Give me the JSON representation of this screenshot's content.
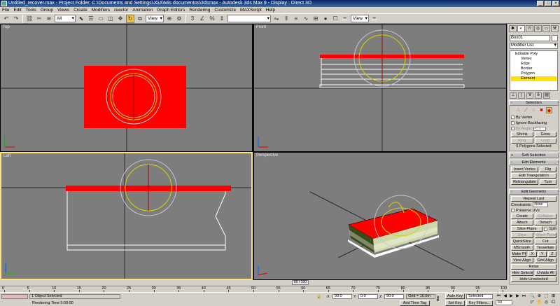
{
  "window": {
    "title": "Untitled_recover.max     - Project Folder: C:\\Documents and Settings\\JGA\\Mis documentos\\3dsmax     - Autodesk 3ds Max 9     - Display : Direct 3D",
    "controls": [
      "_",
      "□",
      "×"
    ]
  },
  "menu": [
    "File",
    "Edit",
    "Tools",
    "Group",
    "Views",
    "Create",
    "Modifiers",
    "reactor",
    "Animation",
    "Graph Editors",
    "Rendering",
    "Customize",
    "MAXScript",
    "Help"
  ],
  "toolbar": {
    "filter": "All",
    "refcoord": "View",
    "named_selection": "",
    "view2": "View"
  },
  "viewports": {
    "top": "Top",
    "front": "Front",
    "left": "Left",
    "perspective": "Perspective"
  },
  "panel": {
    "object_name": "Box01",
    "modifier_list": "Modifier List",
    "stack": {
      "root": "Editable Poly",
      "items": [
        "Vertex",
        "Edge",
        "Border",
        "Polygon",
        "Element"
      ],
      "selected": "Element"
    },
    "selection": {
      "title": "Selection",
      "by_vertex": "By Vertex",
      "ignore_backfacing": "Ignore Backfacing",
      "by_angle": "By Angle:",
      "angle_value": "45.0",
      "shrink": "Shrink",
      "grow": "Grow",
      "ring": "Ring",
      "loop": "Loop",
      "status": "6 Polygons Selected"
    },
    "soft_selection": "Soft Selection",
    "edit_elements": {
      "title": "Edit Elements",
      "insert_vertex": "Insert Vertex",
      "flip": "Flip",
      "edit_triangulation": "Edit Triangulation",
      "retriangulate": "Retriangulate",
      "turn": "Turn"
    },
    "edit_geometry": {
      "title": "Edit Geometry",
      "repeat_last": "Repeat Last",
      "constraints": "Constraints:",
      "constraints_value": "None",
      "preserve_uvs": "Preserve UVs",
      "create": "Create",
      "collapse": "Collapse",
      "attach": "Attach",
      "detach": "Detach",
      "slice_plane": "Slice Plane",
      "split": "Split",
      "slice": "Slice",
      "reset_plane": "Reset Plane",
      "quickslice": "QuickSlice",
      "cut": "Cut",
      "msmooth": "MSmooth",
      "tessellate": "Tessellate",
      "make_planar": "Make Planar",
      "x": "X",
      "y": "Y",
      "z": "Z",
      "view_align": "View Align",
      "grid_align": "Grid Align",
      "relax": "Relax",
      "hide_selected": "Hide Selected",
      "unhide_all": "Unhide All",
      "hide_unselected": "Hide Unselected"
    }
  },
  "timeline": {
    "slider": "60 / 100",
    "ticks": [
      "0",
      "5",
      "10",
      "15",
      "20",
      "25",
      "30",
      "35",
      "40",
      "45",
      "50",
      "55",
      "60",
      "65",
      "70",
      "75",
      "80",
      "85",
      "90",
      "95",
      "100"
    ]
  },
  "status": {
    "objects": "1 Object Selected",
    "rendering": "Rendering Time  0:00:00",
    "x_label": "X",
    "x_value": "90.0",
    "y_label": "Y",
    "y_value": "0.0",
    "z_label": "Z",
    "z_value": "90.0",
    "grid": "Grid = 10.0m",
    "auto_key": "Auto Key",
    "set_key": "Set Key",
    "selected": "Selected",
    "key_filters": "Key Filters...",
    "add_time_tag": "Add Time Tag",
    "frame": "60"
  },
  "colors": {
    "viewport_bg": "#7d7d7d",
    "object_red": "#ff0000",
    "selection_yellow": "#ffe000"
  }
}
